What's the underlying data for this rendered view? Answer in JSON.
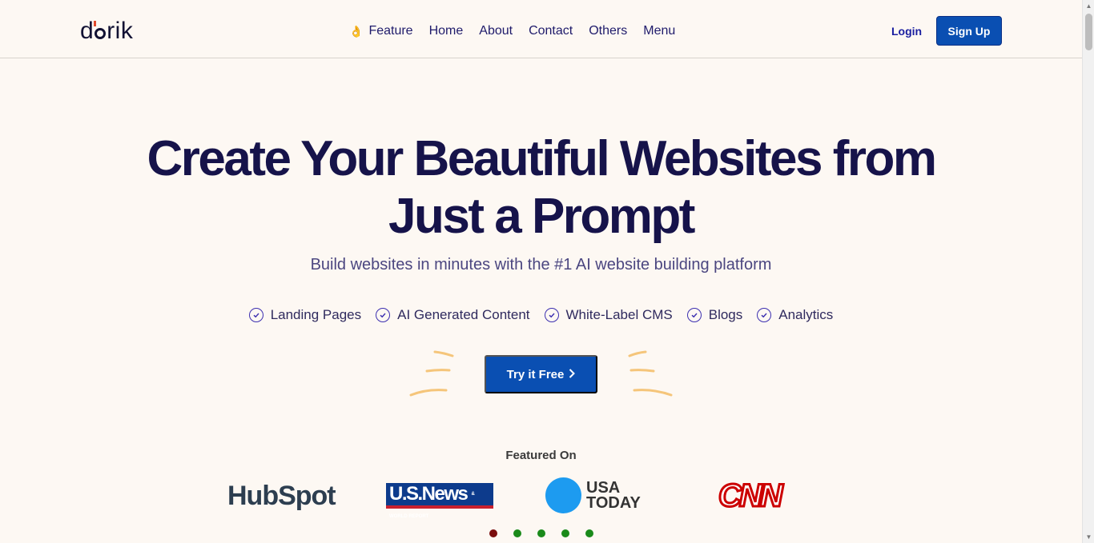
{
  "header": {
    "logo_text_pre": "d",
    "logo_text_post": "rik",
    "nav": [
      {
        "label": "Feature",
        "emoji": "👌"
      },
      {
        "label": "Home"
      },
      {
        "label": "About"
      },
      {
        "label": "Contact"
      },
      {
        "label": "Others"
      },
      {
        "label": "Menu"
      }
    ],
    "login_label": "Login",
    "signup_label": "Sign Up"
  },
  "hero": {
    "title_line1": "Create Your Beautiful Websites from",
    "title_line2": "Just a Prompt",
    "subtitle": "Build websites in minutes with the #1 AI website building platform",
    "features": [
      "Landing Pages",
      "AI Generated Content",
      "White-Label CMS",
      "Blogs",
      "Analytics"
    ],
    "cta_label": "Try it Free"
  },
  "featured": {
    "label": "Featured On",
    "logos": {
      "hubspot": "HubSpot",
      "usnews": "U.S.News",
      "usnews_small": "& WORLD REPORT",
      "usatoday_line1": "USA",
      "usatoday_line2": "TODAY",
      "cnn": "CNN"
    }
  },
  "carousel": {
    "dot_colors": [
      "#7a0d0d",
      "#1a8a1a",
      "#1a8a1a",
      "#1a8a1a",
      "#1a8a1a"
    ]
  },
  "colors": {
    "brand_blue": "#0a4fb2",
    "navy": "#16134a",
    "background": "#fdf8f3",
    "spark": "#f5c57a"
  }
}
